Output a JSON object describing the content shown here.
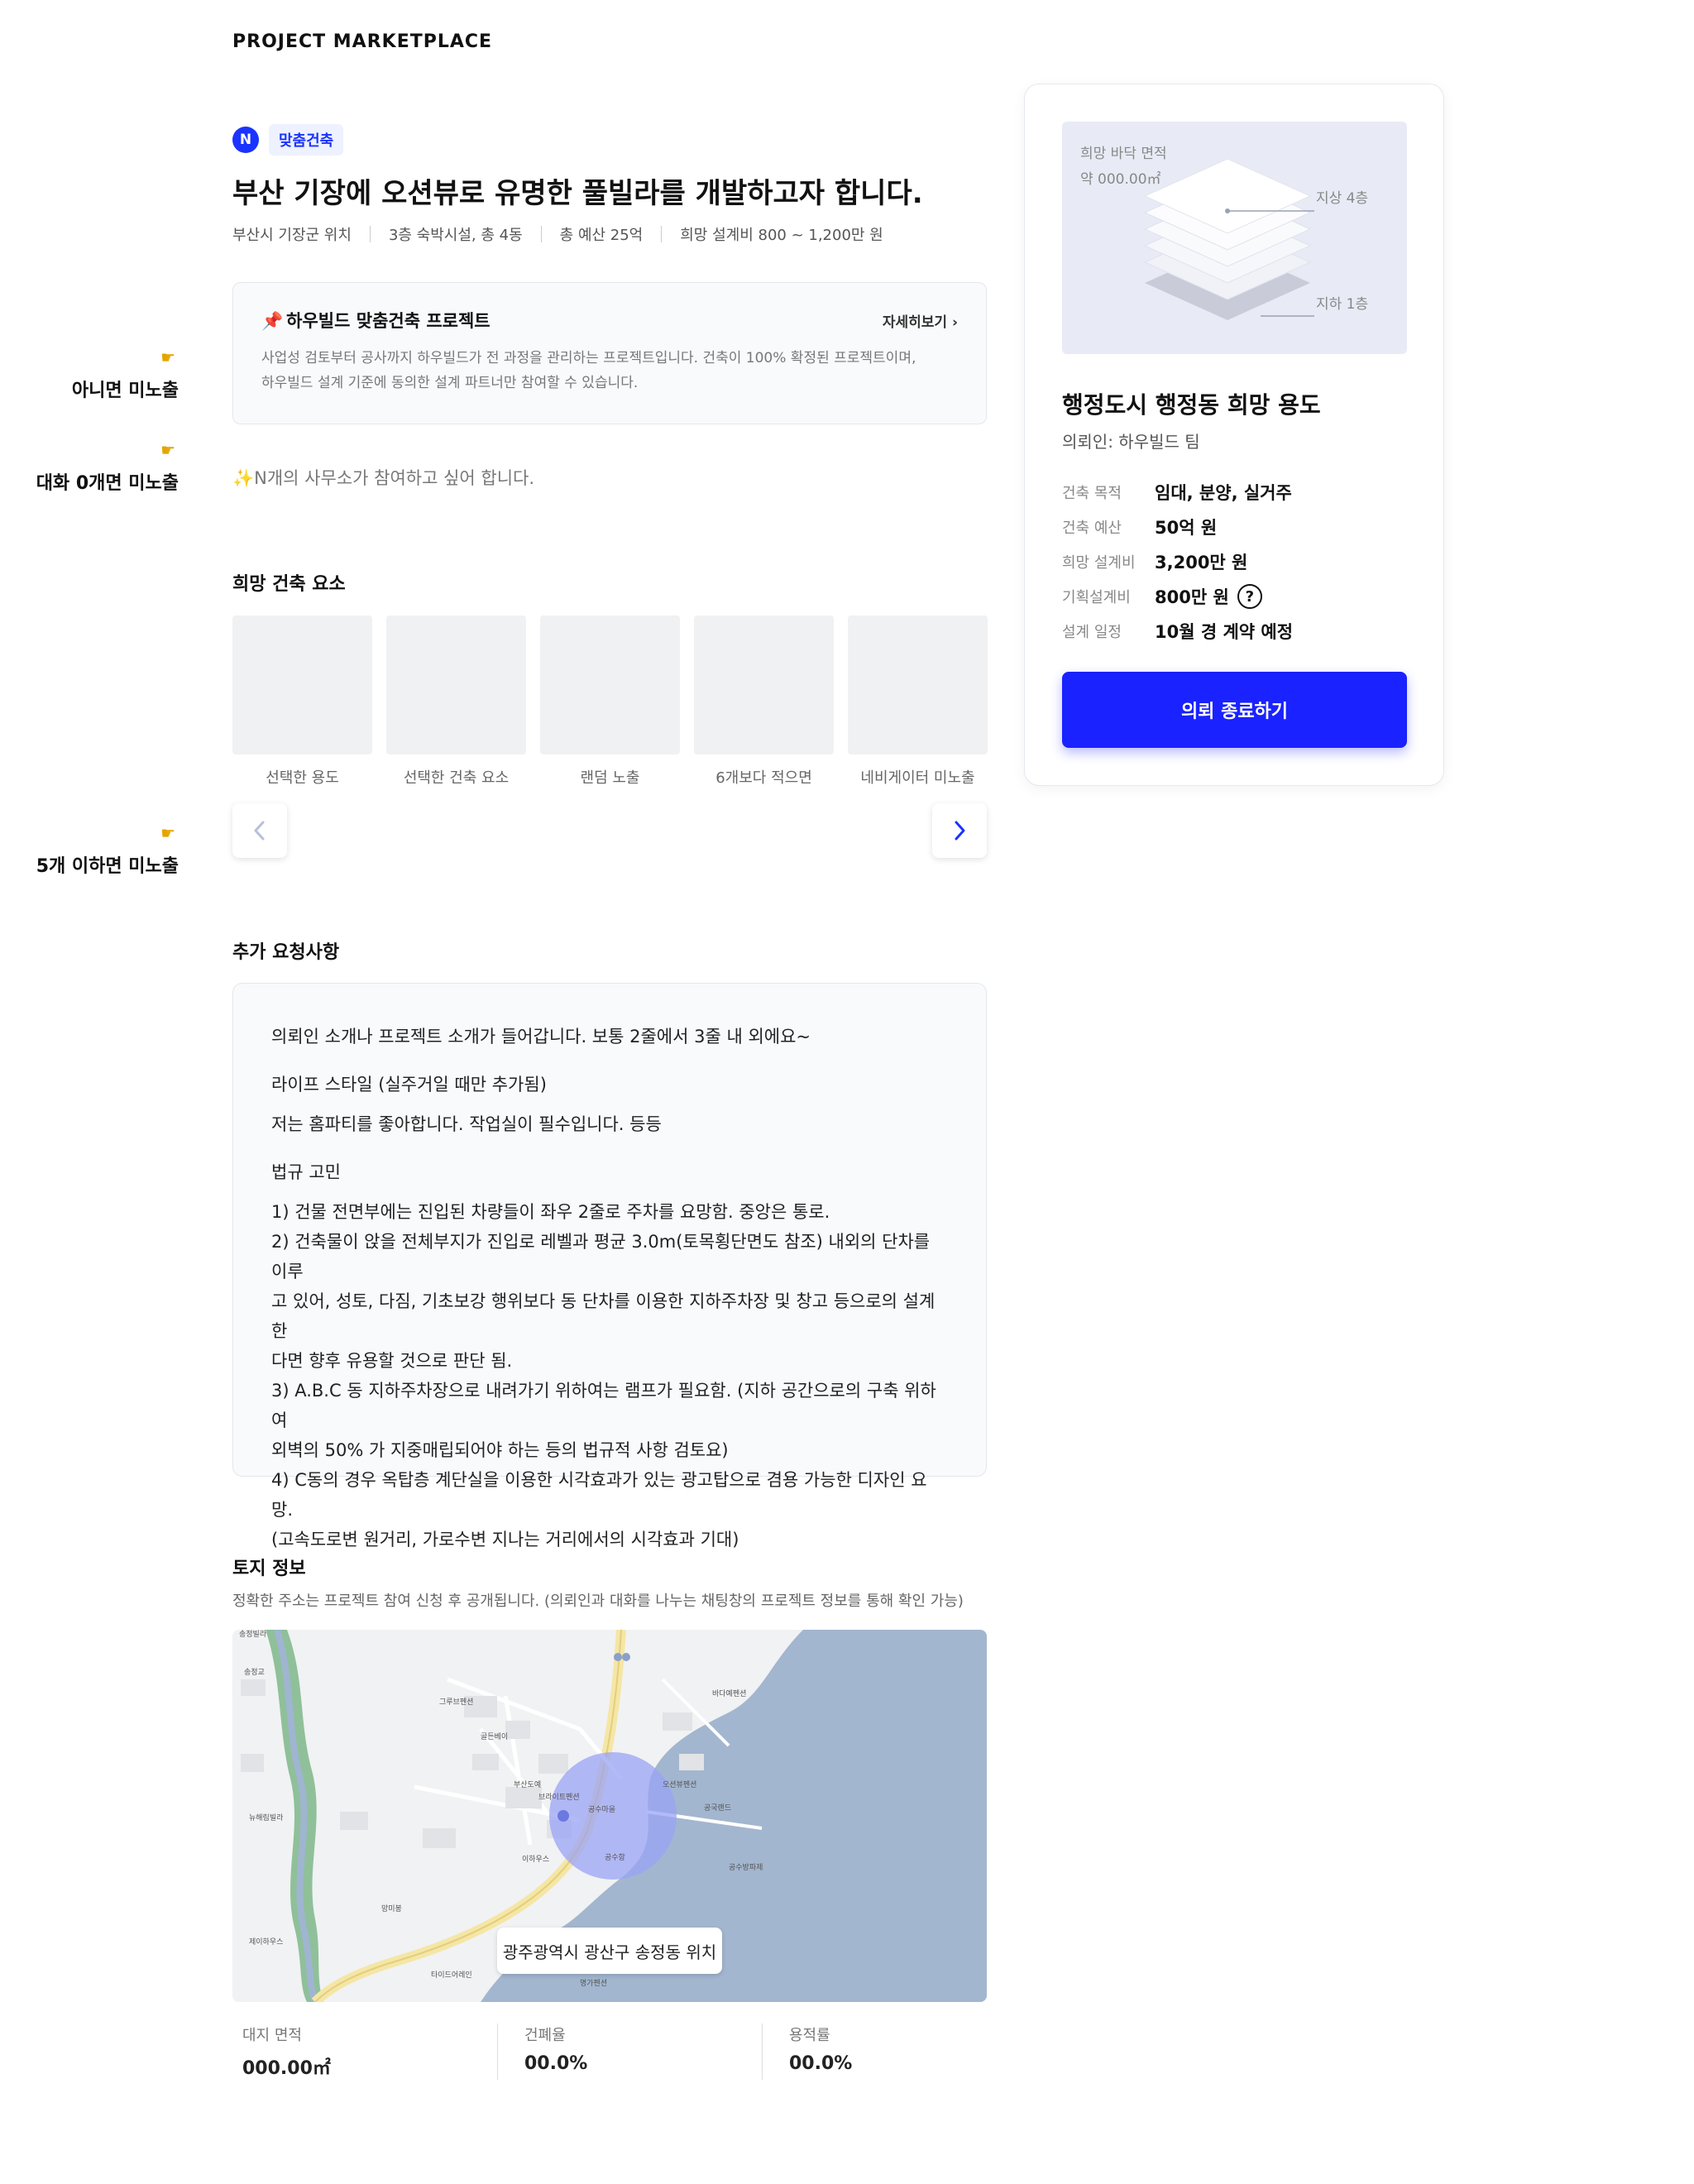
{
  "brand": "PROJECT MARKETPLACE",
  "annotations": [
    "아니면 미노출",
    "대화 0개면 미노출",
    "5개 이하면 미노출"
  ],
  "project": {
    "badge_letter": "N",
    "badge_label": "맞춤건축",
    "title": "부산 기장에 오션뷰로 유명한 풀빌라를 개발하고자 합니다.",
    "meta": [
      "부산시 기장군 위치",
      "3층 숙박시설, 총 4동",
      "총 예산 25억",
      "희망 설계비 800 ~ 1,200만 원"
    ]
  },
  "info_box": {
    "title": "하우빌드 맞춤건축 프로젝트",
    "more": "자세히보기",
    "desc_1": "사업성 검토부터 공사까지 하우빌드가 전 과정을 관리하는 프로젝트입니다. 건축이 100% 확정된 프로젝트이며,",
    "desc_2": "하우빌드 설계 기준에 동의한 설계 파트너만 참여할 수 있습니다."
  },
  "participants_text": "N개의 사무소가 참여하고 싶어 합니다.",
  "elements": {
    "title": "희망 건축 요소",
    "cards": [
      "선택한 용도",
      "선택한 건축 요소",
      "랜덤 노출",
      "6개보다 적으면",
      "네비게이터 미노출"
    ]
  },
  "request": {
    "title": "추가 요청사항",
    "intro": "의뢰인 소개나 프로젝트 소개가 들어갑니다. 보통 2줄에서 3줄 내 외에요~",
    "life_heading": "라이프 스타일 (실주거일 때만 추가됨)",
    "life_text": "저는 홈파티를 좋아합니다. 작업실이 필수입니다. 등등",
    "law_heading": "법규 고민",
    "law_lines": [
      "1) 건물 전면부에는 진입된 차량들이 좌우 2줄로 주차를 요망함. 중앙은 통로.",
      "2) 건축물이 앉을 전체부지가 진입로 레벨과 평균 3.0m(토목횡단면도 참조) 내외의 단차를 이루",
      "고 있어, 성토, 다짐, 기초보강 행위보다 동 단차를 이용한 지하주차장 및 창고 등으로의 설계한",
      "다면 향후 유용할 것으로 판단 됨.",
      "3) A.B.C 동 지하주차장으로 내려가기 위하여는 램프가 필요함. (지하 공간으로의 구축 위하여",
      "외벽의 50% 가 지중매립되어야 하는 등의 법규적 사항 검토요)",
      "4) C동의 경우 옥탑층 계단실을 이용한 시각효과가 있는 광고탑으로 겸용 가능한 디자인 요망.",
      "(고속도로변 원거리, 가로수변 지나는 거리에서의 시각효과 기대)"
    ]
  },
  "land": {
    "title": "토지 정보",
    "subtitle": "정확한 주소는 프로젝트 참여 신청 후 공개됩니다. (의뢰인과 대화를 나누는 채팅창의 프로젝트 정보를 통해 확인 가능)",
    "address": "광주광역시 광산구 송정동 위치",
    "stats": [
      {
        "label": "대지 면적",
        "value": "000.00㎡"
      },
      {
        "label": "건폐율",
        "value": "00.0%"
      },
      {
        "label": "용적률",
        "value": "00.0%"
      }
    ]
  },
  "sidebar": {
    "area_label": "희망 바닥 면적",
    "area_value": "약 000.00㎡",
    "floor_up": "지상 4층",
    "floor_down": "지하 1층",
    "title": "행정도시 행정동 희망 용도",
    "requester": "의뢰인: 하우빌드 팀",
    "rows": [
      {
        "key": "건축 목적",
        "value": "임대, 분양, 실거주"
      },
      {
        "key": "건축 예산",
        "value": "50억 원"
      },
      {
        "key": "희망 설계비",
        "value": "3,200만 원"
      },
      {
        "key": "기획설계비",
        "value": "800만 원"
      },
      {
        "key": "설계 일정",
        "value": "10월 경 계약 예정"
      }
    ],
    "help_mark": "?",
    "cta": "의뢰 종료하기"
  },
  "colors": {
    "accent": "#1a22ff",
    "map_water": "#a3b6cf",
    "map_circle": "#9aa3f5"
  }
}
